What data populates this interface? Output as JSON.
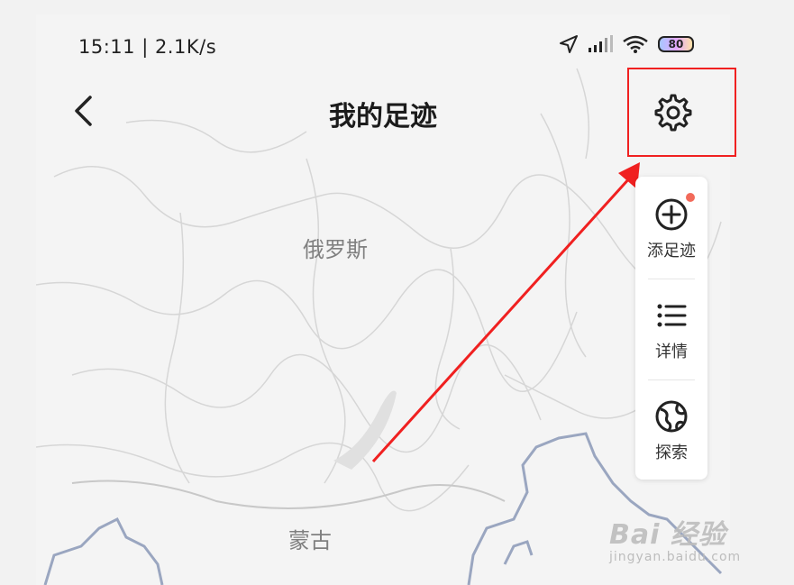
{
  "status_bar": {
    "time_speed": "15:11 | 2.1K/s",
    "battery": "80"
  },
  "header": {
    "title": "我的足迹"
  },
  "side_panel": {
    "items": [
      {
        "label": "添足迹",
        "icon": "add-circle-icon"
      },
      {
        "label": "详情",
        "icon": "list-icon"
      },
      {
        "label": "探索",
        "icon": "globe-icon"
      }
    ]
  },
  "map": {
    "labels": {
      "russia": "俄罗斯",
      "mongolia": "蒙古"
    }
  },
  "watermark": {
    "main": "Bai 经验",
    "sub": "jingyan.baidu.com"
  },
  "colors": {
    "annotation": "#f02020",
    "map_border": "#9aa6c0",
    "map_bg": "#f4f4f4"
  }
}
